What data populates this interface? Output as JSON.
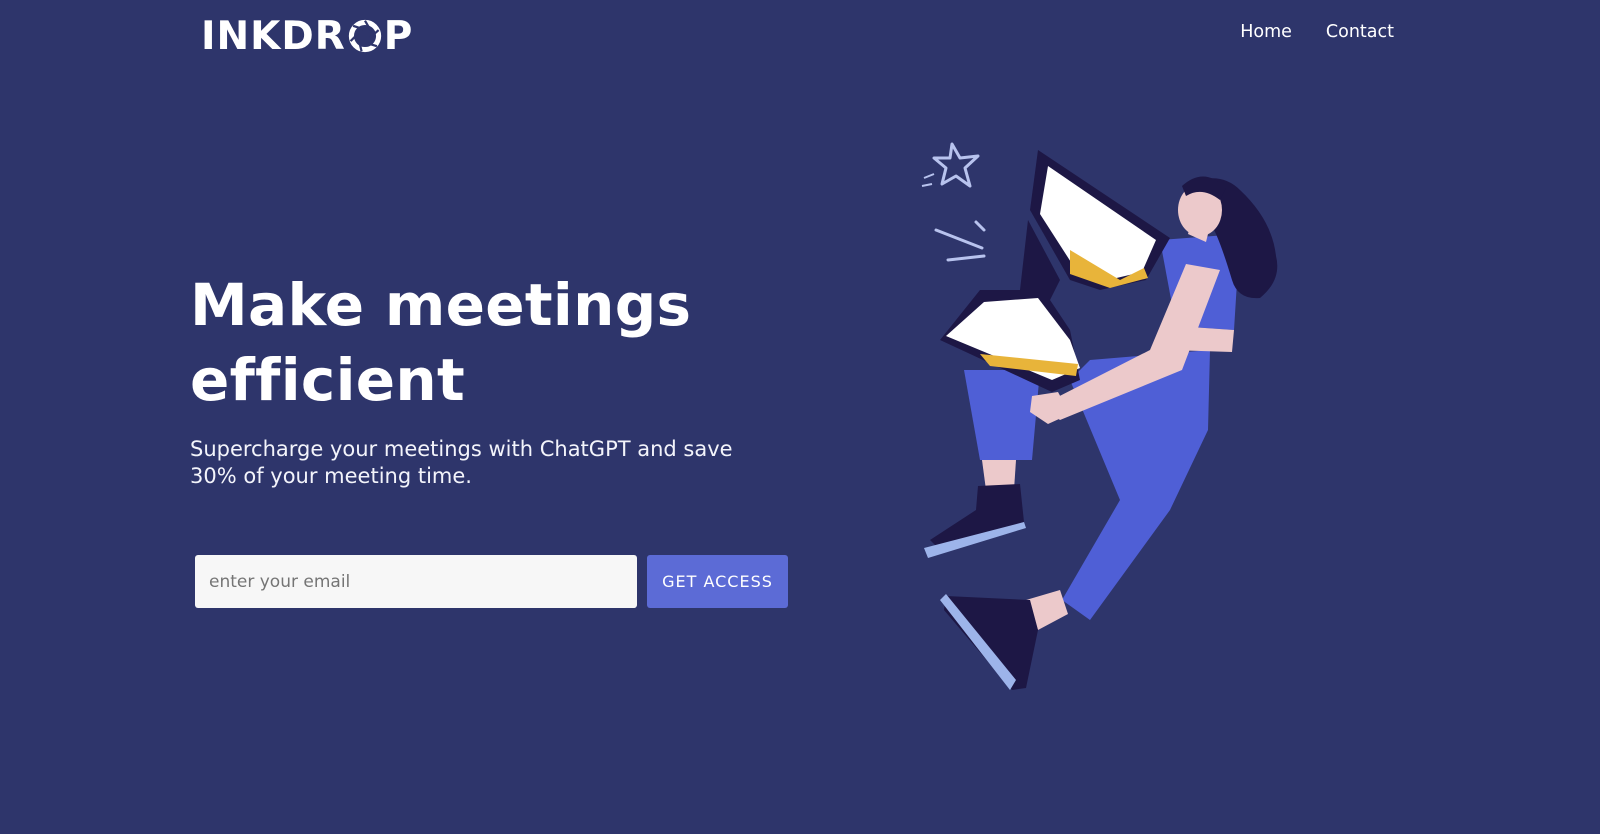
{
  "header": {
    "logo_text_left": "INKDR",
    "logo_text_right": "P",
    "nav": {
      "home": "Home",
      "contact": "Contact"
    }
  },
  "hero": {
    "title_line1": "Make meetings",
    "title_line2": "efficient",
    "subtitle": "Supercharge your meetings with ChatGPT and save 30% of your meeting time."
  },
  "signup": {
    "email_placeholder": "enter your email",
    "email_value": "",
    "button_label": "GET ACCESS"
  },
  "colors": {
    "background": "#2e356b",
    "button": "#5c6bd6",
    "input_bg": "#f7f7f7",
    "illustration_blue": "#4f5fd6",
    "illustration_dark": "#1d1745",
    "illustration_skin": "#ecc9cb",
    "sand": "#e8b43a"
  },
  "icons": {
    "logo_o": "aperture-icon",
    "illustration": "woman-carrying-hourglass"
  }
}
